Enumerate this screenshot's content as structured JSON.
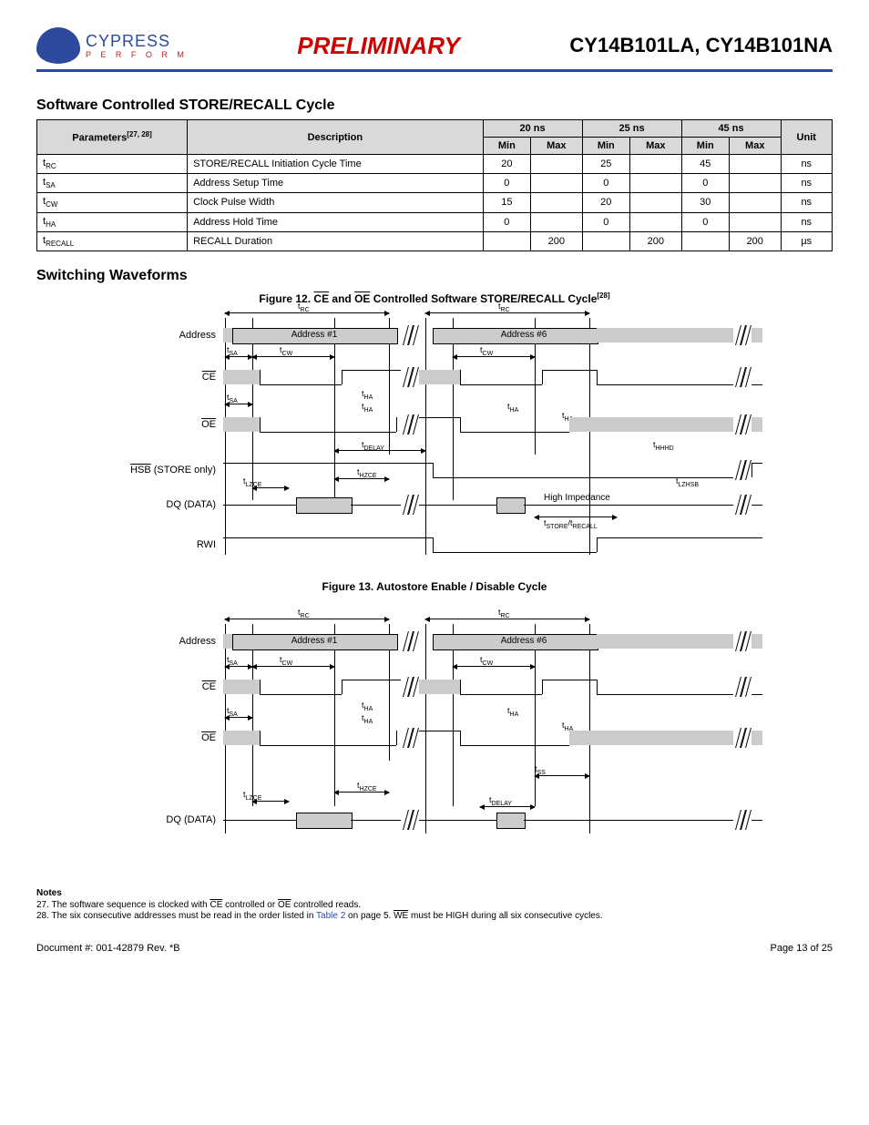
{
  "header": {
    "logo_name": "CYPRESS",
    "logo_tagline": "P E R F O R M",
    "preliminary": "PRELIMINARY",
    "part_numbers": "CY14B101LA, CY14B101NA"
  },
  "section1_title": "Software Controlled STORE/RECALL Cycle",
  "table": {
    "head": {
      "parameters": "Parameters",
      "param_refs": "[27, 28]",
      "description": "Description",
      "col20": "20 ns",
      "col25": "25 ns",
      "col45": "45 ns",
      "min": "Min",
      "max": "Max",
      "unit": "Unit"
    },
    "rows": [
      {
        "param": "t",
        "psub": "RC",
        "desc": "STORE/RECALL Initiation Cycle Time",
        "min20": "20",
        "max20": "",
        "min25": "25",
        "max25": "",
        "min45": "45",
        "max45": "",
        "unit": "ns"
      },
      {
        "param": "t",
        "psub": "SA",
        "desc": "Address Setup Time",
        "min20": "0",
        "max20": "",
        "min25": "0",
        "max25": "",
        "min45": "0",
        "max45": "",
        "unit": "ns"
      },
      {
        "param": "t",
        "psub": "CW",
        "desc": "Clock Pulse Width",
        "min20": "15",
        "max20": "",
        "min25": "20",
        "max25": "",
        "min45": "30",
        "max45": "",
        "unit": "ns"
      },
      {
        "param": "t",
        "psub": "HA",
        "desc": "Address Hold Time",
        "min20": "0",
        "max20": "",
        "min25": "0",
        "max25": "",
        "min45": "0",
        "max45": "",
        "unit": "ns"
      },
      {
        "param": "t",
        "psub": "RECALL",
        "desc": "RECALL Duration",
        "min20": "",
        "max20": "200",
        "min25": "",
        "max25": "200",
        "min45": "",
        "max45": "200",
        "unit": "µs"
      }
    ]
  },
  "section2_title": "Switching Waveforms",
  "fig12": {
    "caption_prefix": "Figure 12.  ",
    "caption_sig1": "CE",
    "caption_mid": " and ",
    "caption_sig2": "OE",
    "caption_suffix": " Controlled Software STORE/RECALL Cycle",
    "caption_ref": "[28]",
    "labels": {
      "address": "Address",
      "addr1": "Address #1",
      "addr6": "Address #6",
      "ce": "CE",
      "oe": "OE",
      "hsb": "HSB",
      "hsb_note": " (STORE only)",
      "dq": "DQ (DATA)",
      "rwi": "RWI",
      "hi_imp": "High Impedance",
      "t_rc": "RC",
      "t_sa": "SA",
      "t_cw": "CW",
      "t_ha": "HA",
      "t_delay": "DELAY",
      "t_hzce": "HZCE",
      "t_lzce": "LZCE",
      "t_hhhd": "HHHD",
      "t_lzhsb": "LZHSB",
      "t_store_recall": "STORE",
      "t_recall2": "RECALL"
    }
  },
  "fig13": {
    "caption": "Figure 13.  Autostore Enable / Disable Cycle",
    "labels": {
      "address": "Address",
      "addr1": "Address #1",
      "addr6": "Address #6",
      "ce": "CE",
      "oe": "OE",
      "dq": "DQ (DATA)",
      "t_rc": "RC",
      "t_sa": "SA",
      "t_cw": "CW",
      "t_ha": "HA",
      "t_hzce": "HZCE",
      "t_lzce": "LZCE",
      "t_delay": "DELAY",
      "t_ss": "SS"
    }
  },
  "notes": {
    "title": "Notes",
    "n27_num": "27.",
    "n27_a": " The software sequence is clocked with ",
    "n27_sig1": "CE",
    "n27_b": " controlled or ",
    "n27_sig2": "OE",
    "n27_c": " controlled reads.",
    "n28_num": "28.",
    "n28_a": " The six consecutive addresses must be read in the order listed in ",
    "n28_link": "Table 2",
    "n28_b": " on page 5. ",
    "n28_sig": "WE",
    "n28_c": " must be HIGH during all six consecutive cycles."
  },
  "footer": {
    "doc": "Document #: 001-42879  Rev. *B",
    "page": "Page 13 of 25"
  }
}
